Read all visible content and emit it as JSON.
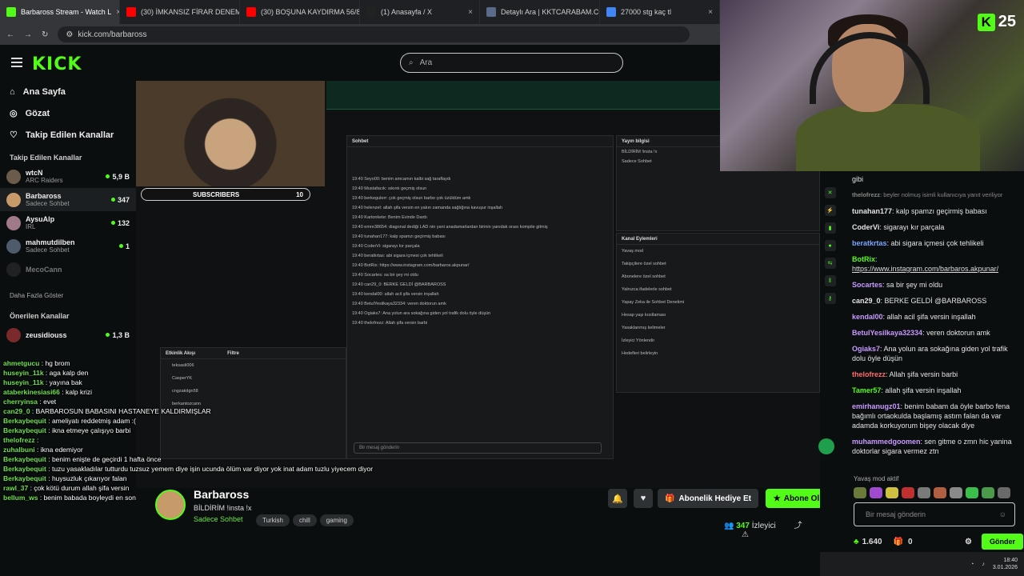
{
  "browser": {
    "tabs": [
      {
        "label": "Barbaross Stream - Watch L",
        "color": "#53fc18",
        "active": true
      },
      {
        "label": "(30) İMKANSIZ FİRAR DENEME",
        "color": "#ff0000"
      },
      {
        "label": "(30) BOŞUNA KAYDIRMA 56/8",
        "color": "#ff0000"
      },
      {
        "label": "(1) Anasayfa / X",
        "color": "#222222"
      },
      {
        "label": "Detaylı Ara | KKTCARABAM.CO",
        "color": "#5a6b8a"
      },
      {
        "label": "27000 stg kaç tl",
        "color": "#4285f4"
      }
    ],
    "url": "kick.com/barbaross"
  },
  "header": {
    "logo": "KICK",
    "search_placeholder": "Ara"
  },
  "sidebar": {
    "nav": [
      {
        "label": "Ana Sayfa",
        "icon": "home-icon"
      },
      {
        "label": "Gözat",
        "icon": "compass-icon"
      },
      {
        "label": "Takip Edilen Kanallar",
        "icon": "heart-icon"
      }
    ],
    "followed_heading": "Takip Edilen Kanallar",
    "followed": [
      {
        "name": "wtcN",
        "category": "ARC Raiders",
        "viewers": "5,9 B",
        "color": "#6b5b4a"
      },
      {
        "name": "Barbaross",
        "category": "Sadece Sohbet",
        "viewers": "347",
        "color": "#c79a6a"
      },
      {
        "name": "AysuAlp",
        "category": "IRL",
        "viewers": "132",
        "color": "#a07a88"
      },
      {
        "name": "mahmutdilben",
        "category": "Sadece Sohbet",
        "viewers": "1",
        "color": "#4f5a6a"
      },
      {
        "name": "MecoCann",
        "category": "",
        "viewers": "",
        "color": "#3a3a3a"
      }
    ],
    "show_more": "Daha Fazla Göster",
    "recommended_heading": "Önerilen Kanallar",
    "recommended": [
      {
        "name": "zeusidiouss",
        "viewers": "1,3 B"
      }
    ]
  },
  "video": {
    "subscribers_label": "SUBSCRIBERS",
    "subscribers_count": "10",
    "inner_chat": {
      "header": "Sohbet",
      "messages": [
        "19:40 Seyo00: benim amcamın kalbi sağ taraflaydı",
        "19:40 Mustafacık: sıkıntı geçmiş olsun",
        "19:40 berkegulerr: çok geçmiş olsun barbo çok üzüldüm amk",
        "19:40 helenzel: allah şifa versin en yakın zamanda sağlığına kavuşur inşallah",
        "19:40 Kartonkete: Benim Evinde Dardı",
        "19:40 emre38654: diagonal dediği LAD nin yani anadamarlardan birinin yanıdak orası kompile gitmiş",
        "19:40 tunahan177: kalp spamzı geçirmiş babası",
        "19:40 CoderVi: sigarayı kır parçala",
        "19:40 beratkrtas: abi sigara içmesi çok tehlikeli",
        "19:40 BotRix: https://www.instagram.com/barbaros.akpunar/",
        "19:40 Socartes: sa bir şey mi oldu",
        "19:40 can29_0: BERKE GELDİ @BARBAROSS",
        "19:40 kendal00: allah acil şifa versin inşallah",
        "19:40 BetulYesilkaya32334: veren doktorun amk",
        "19:40 Ogiaks7: Ana yolun ara sokağına giden yol trafik dolu öyle düşün",
        "19:40 thelofrezz: Allah şifa versin barbi"
      ],
      "input_placeholder": "Bir mesaj gönderin",
      "send_label": "Gönder"
    },
    "info_panel": {
      "header": "Yayın bilgisi",
      "title": "BİLDİRİM !insta !x",
      "category": "Sadece Sohbet",
      "tags": [
        "Turkish",
        "chill",
        "gaming"
      ]
    },
    "actions_panel": {
      "header": "Kanal Eylemleri",
      "items": [
        "Yavaş mod",
        "Takipçilere özel sohbet",
        "Abonelere özel sohbet",
        "Yalnızca ifadelerle sohbet",
        "Yapay Zeka ile Sohbet Denetimi",
        "Hesap yaşı kısıtlaması",
        "Yasaklanmış kelimeler",
        "İzleyici Yönlendir",
        "Hedefleri belirleyin"
      ]
    },
    "activity_panel": {
      "header": "Etkinlik Akışı",
      "filter": "Filtre",
      "items": [
        "teksasli006",
        "CasperYK",
        "cngzakdgn58",
        "berkantozcann"
      ]
    },
    "overlay_chat": [
      {
        "user": "ahmetgucu",
        "text": "hg brom"
      },
      {
        "user": "huseyin_11k",
        "text": "aga kalp den"
      },
      {
        "user": "huseyin_11k",
        "text": "yayına bak"
      },
      {
        "user": "ataberkinesiasi66",
        "text": "kalp krizi"
      },
      {
        "user": "cherryinsa",
        "text": "evet"
      },
      {
        "user": "can29_0",
        "text": "BARBAROSUN BABASINI HASTANEYE KALDIRMIŞLAR"
      },
      {
        "user": "Berkaybequit",
        "text": "ameliyatı reddetmiş adam :("
      },
      {
        "user": "Berkaybequit",
        "text": "ikna etmeye çalışıyo barbi"
      },
      {
        "user": "thelofrezz",
        "text": ""
      },
      {
        "user": "zuhalbuni",
        "text": "ikna edemiyor"
      },
      {
        "user": "Berkaybequit",
        "text": "benim enişte de geçirdi 1 hafta önce"
      },
      {
        "user": "Berkaybequit",
        "text": "tuzu yasakladılar tutturdu tuzsuz yemem diye işin ucunda ölüm var diyor yok inat adam tuzlu yiyecem diyor"
      },
      {
        "user": "Berkaybequit",
        "text": "huysuzluk çıkarıyor falan"
      },
      {
        "user": "rawl_37",
        "text": "çok kötü durum allah şifa versin"
      },
      {
        "user": "bellum_ws",
        "text": "benim babada boyleydi en son hastanelik oldu öyle kabul etti"
      }
    ]
  },
  "stream_info": {
    "name": "Barbaross",
    "title": "BİLDİRİM !insta !x",
    "category": "Sadece Sohbet",
    "tags": [
      "Turkish",
      "chill",
      "gaming"
    ],
    "gift_label": "Abonelik Hediye Et",
    "subscribe_label": "Abone Ol",
    "viewers": "347",
    "viewers_label": "İzleyici"
  },
  "webcam": {
    "sub_count": "25",
    "k_label": "K"
  },
  "chat": {
    "messages": [
      {
        "user": "",
        "text": "gibi",
        "color": "#e4e4e4"
      },
      {
        "user": "thelofrezz",
        "text": "beyler nolmuş isimli kullanıcıya yanıt veriliyor",
        "color": "#888888",
        "reply": true
      },
      {
        "user": "tunahan177",
        "text": "kalp spamzı geçirmiş babası",
        "color": "#e4e4e4"
      },
      {
        "user": "CoderVi",
        "text": "sigarayı kır parçala",
        "color": "#e4e4e4"
      },
      {
        "user": "beratkrtas",
        "text": "abi sigara içmesi çok tehlikeli",
        "color": "#7aa7ff"
      },
      {
        "user": "BotRix",
        "text": "https://www.instagram.com/barbaros.akpunar/",
        "color": "#53fc18",
        "link": true
      },
      {
        "user": "Socartes",
        "text": "sa bir şey mi oldu",
        "color": "#c89bff"
      },
      {
        "user": "can29_0",
        "text": "BERKE GELDİ @BARBAROSS",
        "color": "#e4e4e4"
      },
      {
        "user": "kendal00",
        "text": "allah acil şifa versin inşallah",
        "color": "#c89bff"
      },
      {
        "user": "BetulYesilkaya32334",
        "text": "veren doktorun amk",
        "color": "#c89bff"
      },
      {
        "user": "Ogiaks7",
        "text": "Ana yolun ara sokağına giden yol trafik dolu öyle düşün",
        "color": "#c89bff"
      },
      {
        "user": "thelofrezz",
        "text": "Allah şifa versin barbi",
        "color": "#ff6b6b"
      },
      {
        "user": "Tamer57",
        "text": "allah şifa versin inşallah",
        "color": "#53fc18"
      },
      {
        "user": "emirhanugz01",
        "text": "benim babam da öyle barbo fena bağımlı ortaokulda başlamış astım falan da var adamda korkuyorum bişey olacak diye",
        "color": "#c89bff"
      },
      {
        "user": "muhammedgoomen",
        "text": "sen gitme o zmn hic yanina doktorlar sigara vermez ztn",
        "color": "#c89bff"
      }
    ],
    "slow_mode": "Yavaş mod aktif",
    "input_placeholder": "Bir mesaj gönderin",
    "points": "1.640",
    "gifts": "0",
    "send_label": "Gönder"
  },
  "taskbar": {
    "time": "18:40",
    "date": "3.01.2026"
  },
  "colors": {
    "accent": "#53fc18",
    "bg": "#0b0e0f"
  }
}
